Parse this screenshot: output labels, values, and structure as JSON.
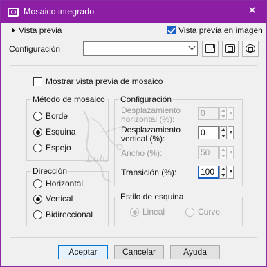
{
  "window": {
    "title": "Mosaico integrado"
  },
  "top": {
    "preview_label": "Vista previa",
    "preview_in_image_label": "Vista previa en imagen",
    "preview_in_image_checked": true
  },
  "config": {
    "label": "Configuración",
    "value": ""
  },
  "options": {
    "show_tile_preview_label": "Mostrar vista previa de mosaico",
    "show_tile_preview_checked": false
  },
  "method": {
    "title": "Método de mosaico",
    "options": [
      "Borde",
      "Esquina",
      "Espejo"
    ],
    "selected": "Esquina"
  },
  "direction": {
    "title": "Dirección",
    "options": [
      "Horizontal",
      "Vertical",
      "Bidireccional"
    ],
    "selected": "Vertical"
  },
  "settings": {
    "title": "Configuración",
    "h_offset_label_1": "Desplazamiento",
    "h_offset_label_2": "horizontal (%):",
    "h_offset_value": "0",
    "v_offset_label_1": "Desplazamiento",
    "v_offset_label_2": "vertical (%):",
    "v_offset_value": "0",
    "width_label": "Ancho (%):",
    "width_value": "50",
    "transition_label": "Transición (%):",
    "transition_value": "100"
  },
  "corner": {
    "title": "Estilo de esquina",
    "options": [
      "Lineal",
      "Curvo"
    ],
    "selected": "Lineal"
  },
  "buttons": {
    "ok": "Aceptar",
    "cancel": "Cancelar",
    "help": "Ayuda"
  },
  "watermark": {
    "text": "Lulu"
  },
  "colors": {
    "titlebar": "#8b1ea3",
    "accent": "#1b61c8"
  }
}
